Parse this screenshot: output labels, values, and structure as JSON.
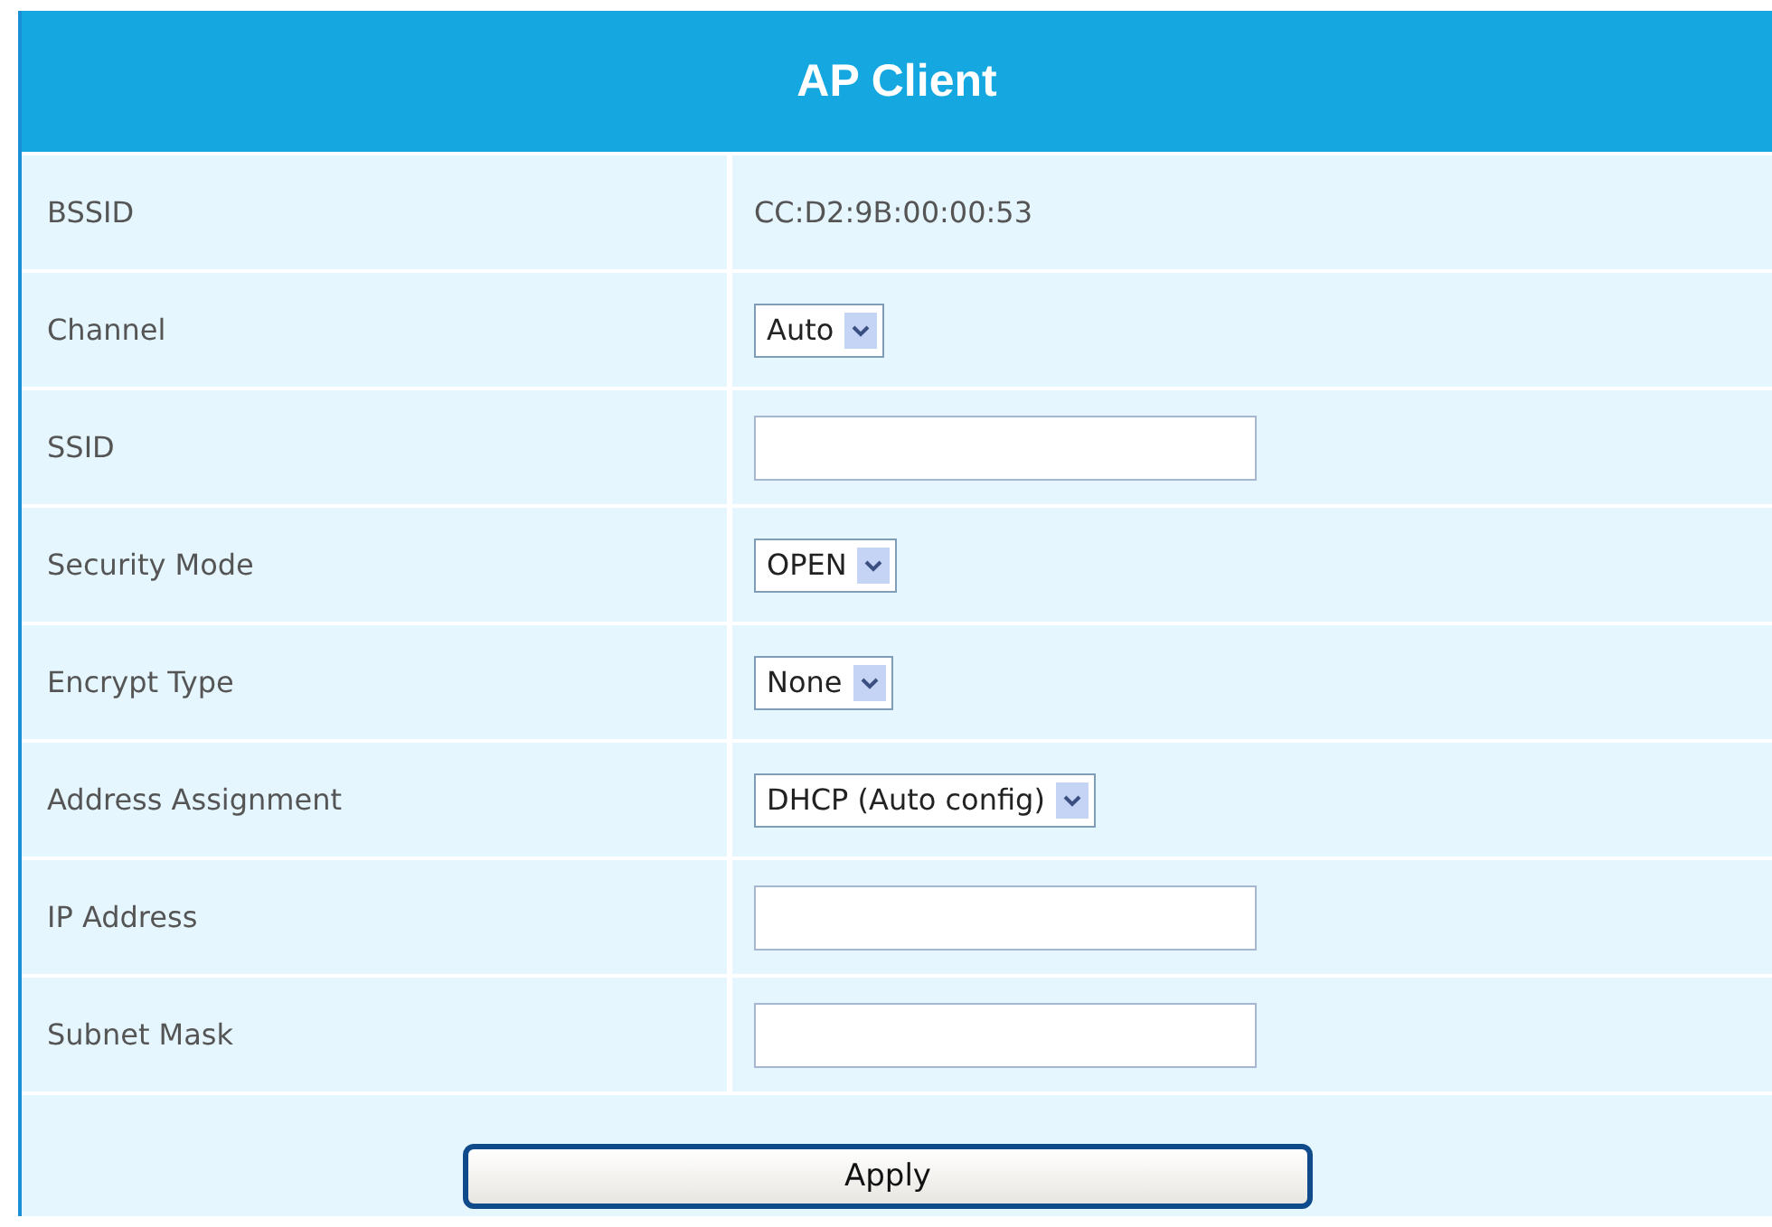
{
  "title": "AP Client",
  "rows": [
    {
      "label": "BSSID",
      "kind": "text",
      "value": "CC:D2:9B:00:00:53"
    },
    {
      "label": "Channel",
      "kind": "select",
      "value": "Auto"
    },
    {
      "label": "SSID",
      "kind": "input"
    },
    {
      "label": "Security Mode",
      "kind": "select",
      "value": "OPEN"
    },
    {
      "label": "Encrypt Type",
      "kind": "select",
      "value": "None"
    },
    {
      "label": "Address Assignment",
      "kind": "select",
      "value": "DHCP (Auto config)"
    },
    {
      "label": "IP Address",
      "kind": "input"
    },
    {
      "label": "Subnet Mask",
      "kind": "input"
    }
  ],
  "button": "Apply"
}
